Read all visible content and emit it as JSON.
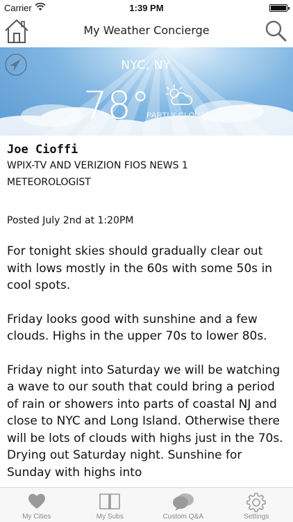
{
  "status_bar": {
    "carrier": "Carrier",
    "time": "1:39 PM"
  },
  "nav": {
    "title": "My Weather Concierge",
    "left_icon": "home-icon",
    "right_icon": "search-icon"
  },
  "weather": {
    "city": "NYC, NY",
    "temperature": "78°",
    "condition": "PARTLY CLOUDY",
    "condition_icon": "partly-cloudy-icon",
    "location_icon": "location-arrow-icon"
  },
  "article": {
    "author_name": "Joe Cioffi",
    "author_title_line1": "WPIX-TV AND VERIZION FIOS NEWS 1",
    "author_title_line2": "METEOROLOGIST",
    "posted": "Posted July 2nd at 1:20PM",
    "paragraphs": [
      "For tonight skies should gradually clear out with lows mostly in the 60s with some 50s in cool spots.",
      "Friday looks good with sunshine and a few clouds. Highs in the upper 70s to lower 80s.",
      "Friday night into Saturday we will be watching a wave to our south that could bring a period of rain or showers into parts of coastal NJ and close to NYC and Long Island. Otherwise there will be lots of clouds with highs just in the 70s. Drying out Saturday night. Sunshine for Sunday with highs into"
    ]
  },
  "tabs": [
    {
      "label": "My Cities",
      "icon": "heart-icon"
    },
    {
      "label": "My Subs",
      "icon": "book-icon"
    },
    {
      "label": "Custom Q&A",
      "icon": "chat-bubbles-icon"
    },
    {
      "label": "Settings",
      "icon": "gear-icon"
    }
  ],
  "colors": {
    "sky": "#6fa9dc",
    "tab_icon": "#9a9a9a"
  }
}
